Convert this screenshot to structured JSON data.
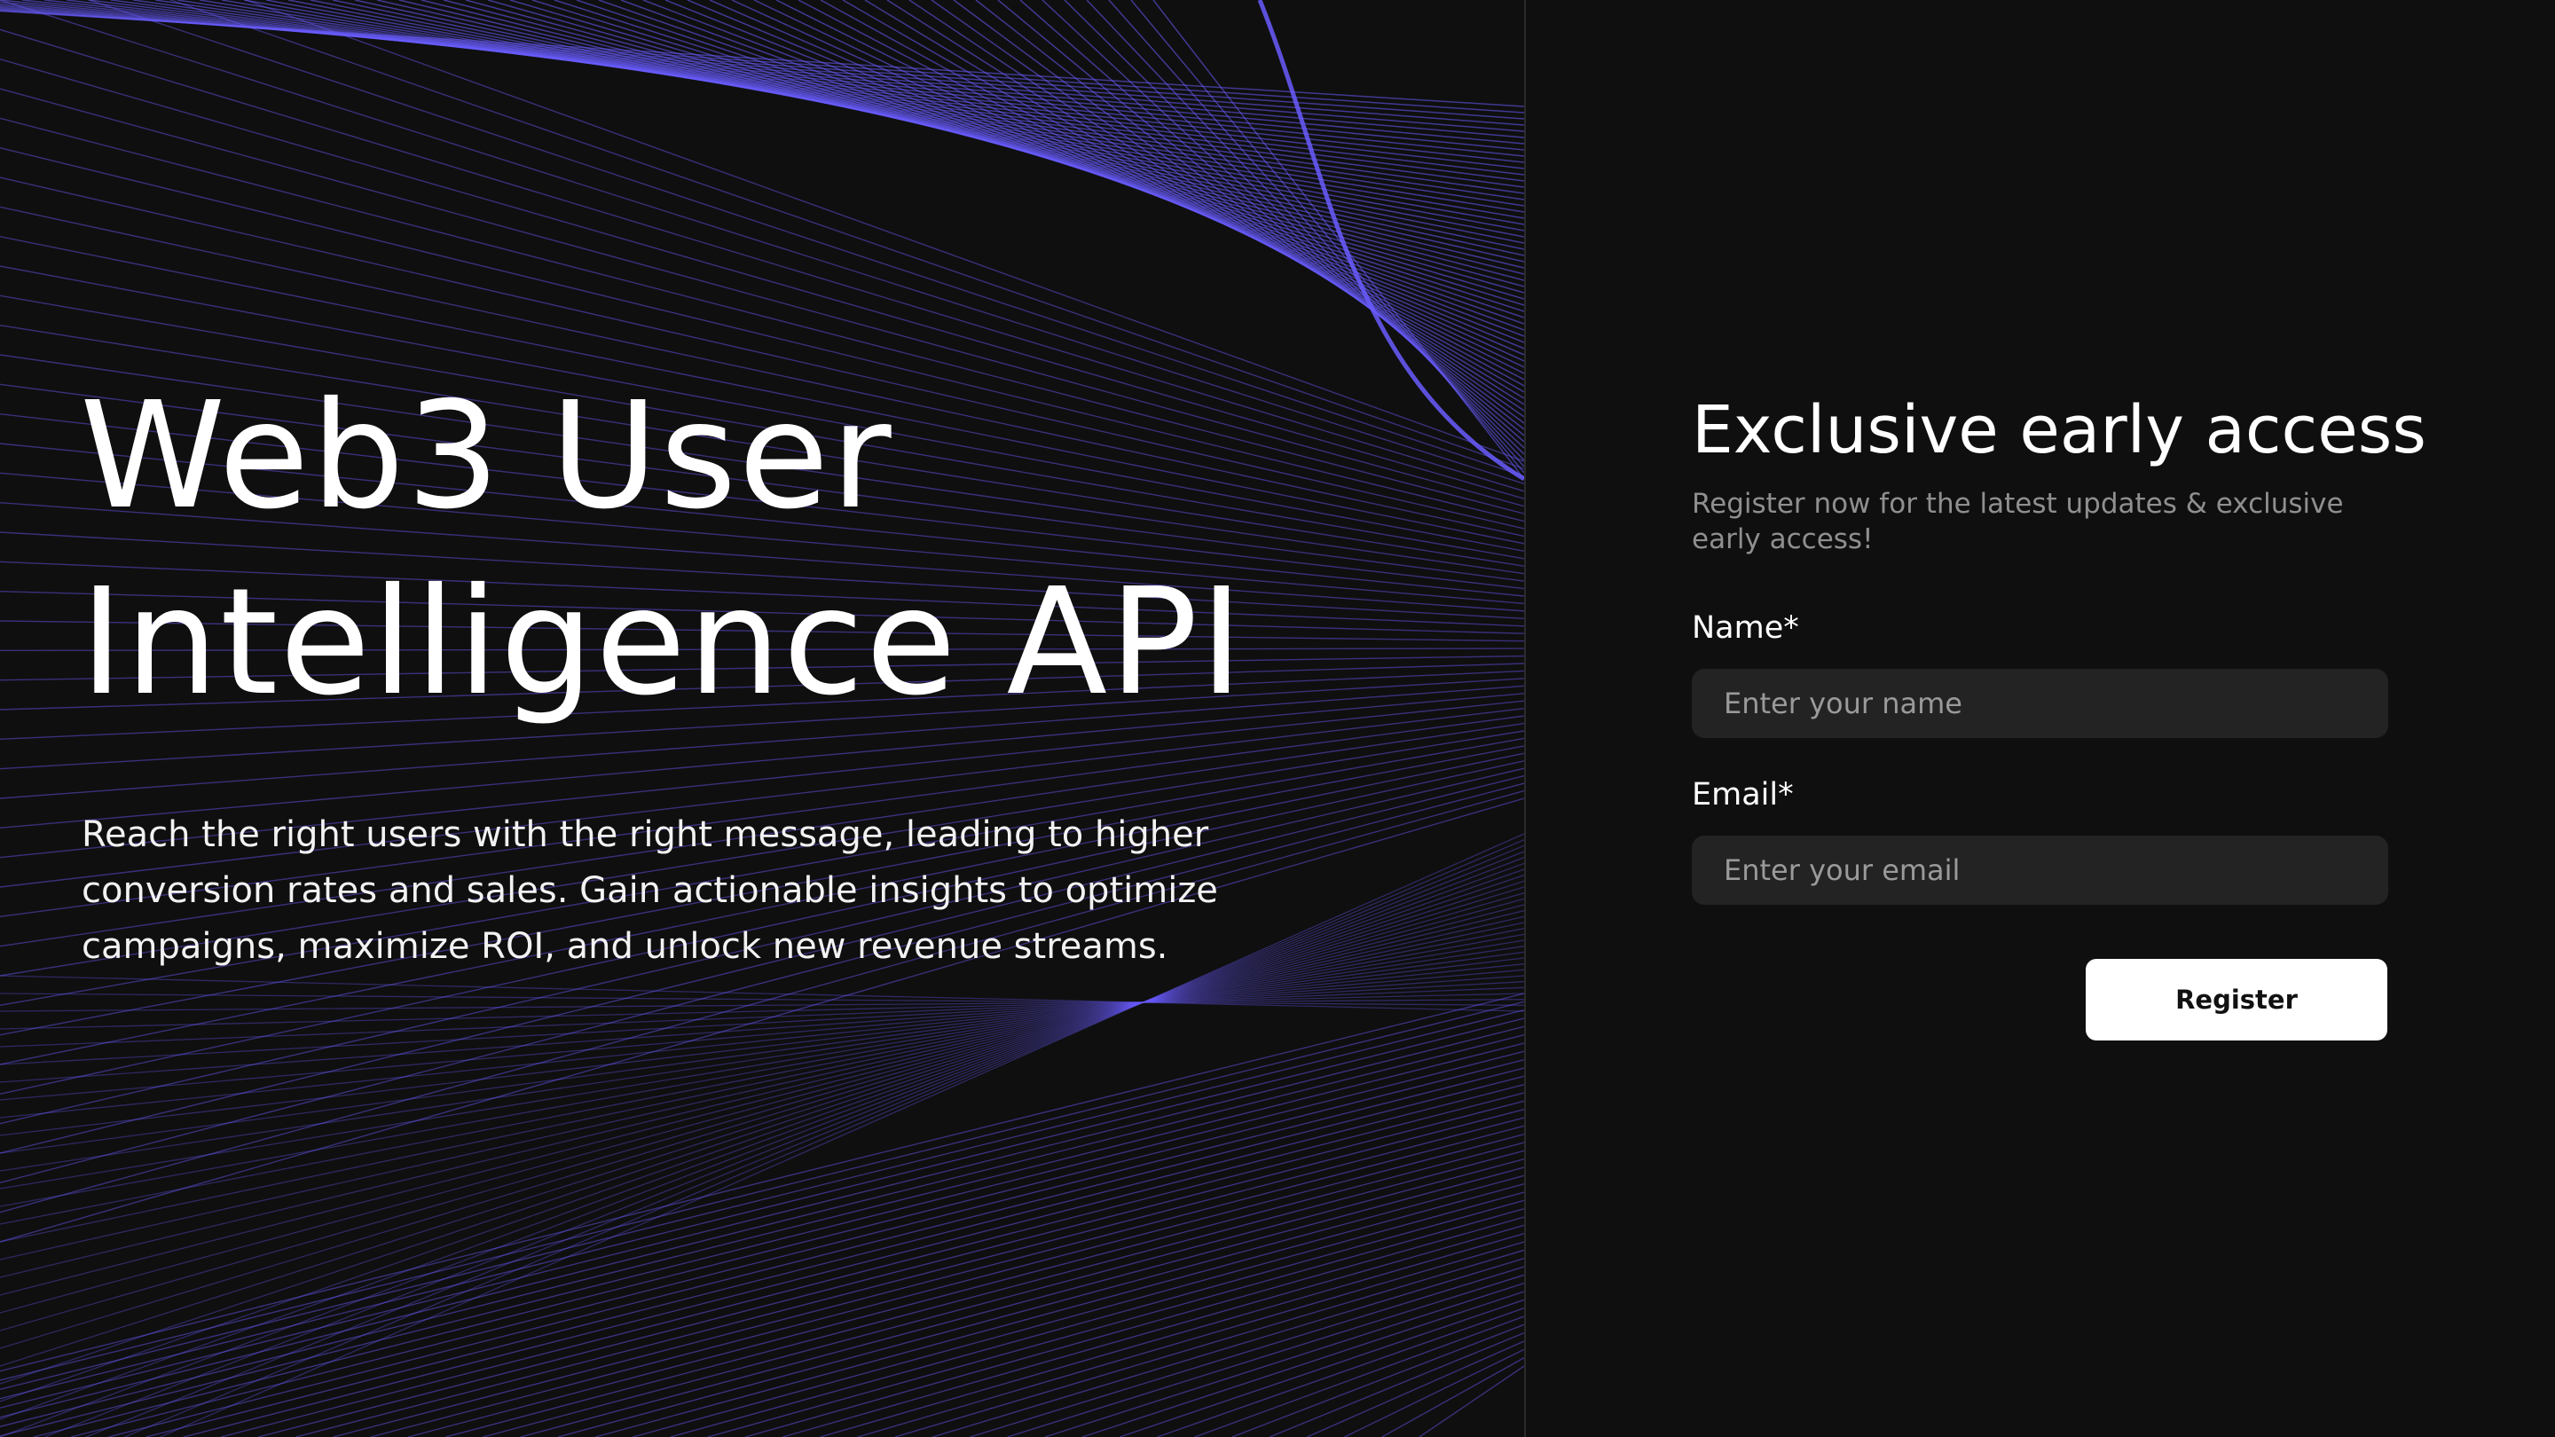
{
  "hero": {
    "title_line1": "Web3 User",
    "title_line2": "Intelligence API",
    "description": "Reach the right users with the right message, leading to higher conversion rates and sales. Gain actionable insights to optimize campaigns, maximize ROI, and unlock new revenue streams."
  },
  "form": {
    "title": "Exclusive early access",
    "subtitle": "Register now for the latest updates & exclusive early access!",
    "name_label": "Name*",
    "name_placeholder": "Enter your name",
    "email_label": "Email*",
    "email_placeholder": "Enter your email",
    "submit_label": "Register"
  },
  "colors": {
    "background": "#0f0f0f",
    "accent_lines": "#6a5cff",
    "input_background": "#232323",
    "button_background": "#ffffff",
    "muted_text": "#8f8f8f"
  }
}
